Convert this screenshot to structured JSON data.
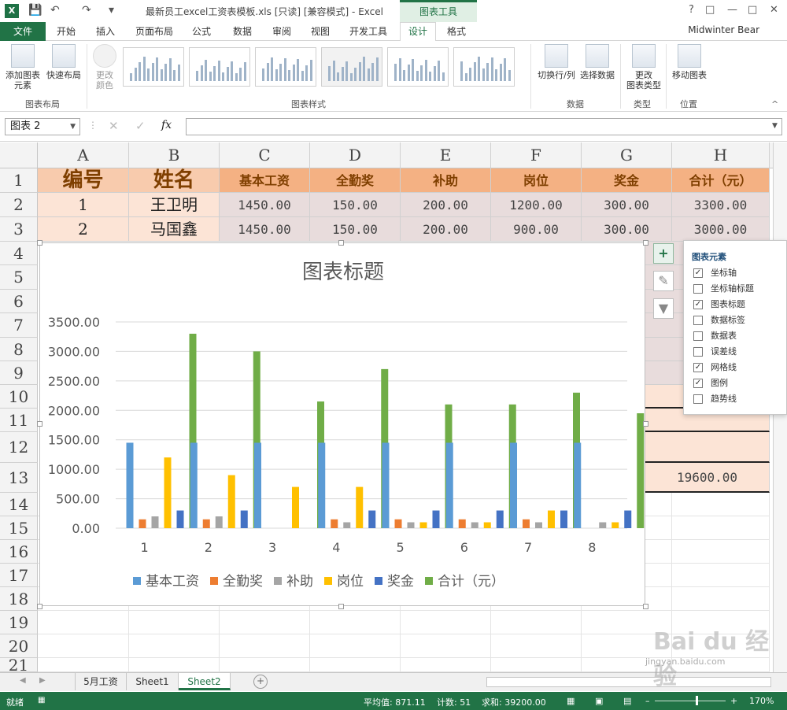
{
  "window": {
    "doc_title": "最新员工excel工资表模板.xls  [只读]  [兼容模式] - Excel",
    "tool_tab": "图表工具",
    "user": "Midwinter Bear",
    "app_icon": "X"
  },
  "tabs": [
    "文件",
    "开始",
    "插入",
    "页面布局",
    "公式",
    "数据",
    "审阅",
    "视图",
    "开发工具",
    "设计",
    "格式"
  ],
  "ribbon": {
    "add_element": "添加图表",
    "add_element2": "元素",
    "quick_layout": "快速布局",
    "change_color": "更改",
    "change_color2": "颜色",
    "group_layout": "图表布局",
    "group_styles": "图表样式",
    "switch_row_col": "切换行/列",
    "select_data": "选择数据",
    "group_data": "数据",
    "change_type": "更改",
    "change_type2": "图表类型",
    "group_type": "类型",
    "move_chart": "移动图表",
    "group_location": "位置"
  },
  "formula": {
    "namebox": "图表 2",
    "fx": "fx"
  },
  "columns": [
    "A",
    "B",
    "C",
    "D",
    "E",
    "F",
    "G",
    "H"
  ],
  "rows": [
    "1",
    "2",
    "3",
    "4",
    "5",
    "6",
    "7",
    "8",
    "9",
    "10",
    "11",
    "12",
    "13",
    "14",
    "15",
    "16",
    "17",
    "18",
    "19",
    "20",
    "21"
  ],
  "table": {
    "headers": [
      "编号",
      "姓名",
      "基本工资",
      "全勤奖",
      "补助",
      "岗位",
      "奖金",
      "合计（元）"
    ],
    "row1": [
      "1",
      "王卫明",
      "1450.00",
      "150.00",
      "200.00",
      "1200.00",
      "300.00",
      "3300.00"
    ],
    "row2": [
      "2",
      "马国鑫",
      "1450.00",
      "150.00",
      "200.00",
      "900.00",
      "300.00",
      "3000.00"
    ],
    "total": "19600.00"
  },
  "chart_data": {
    "type": "bar",
    "title": "图表标题",
    "categories": [
      "1",
      "2",
      "3",
      "4",
      "5",
      "6",
      "7",
      "8"
    ],
    "ylim": [
      0,
      3500
    ],
    "yticks": [
      "3500.00",
      "3000.00",
      "2500.00",
      "2000.00",
      "1500.00",
      "1000.00",
      "500.00",
      "0.00"
    ],
    "grid": true,
    "legend": "bottom",
    "series": [
      {
        "name": "基本工资",
        "color": "#5b9bd5",
        "values": [
          1450,
          1450,
          1450,
          1450,
          1450,
          1450,
          1450,
          1450
        ]
      },
      {
        "name": "全勤奖",
        "color": "#ed7d31",
        "values": [
          150,
          150,
          0,
          150,
          150,
          150,
          150,
          0
        ]
      },
      {
        "name": "补助",
        "color": "#a5a5a5",
        "values": [
          200,
          200,
          0,
          100,
          100,
          100,
          100,
          100
        ]
      },
      {
        "name": "岗位",
        "color": "#ffc000",
        "values": [
          1200,
          900,
          700,
          700,
          100,
          100,
          300,
          100
        ]
      },
      {
        "name": "奖金",
        "color": "#4472c4",
        "values": [
          300,
          300,
          0,
          300,
          300,
          300,
          300,
          300
        ]
      },
      {
        "name": "合计（元）",
        "color": "#70ad47",
        "values": [
          3300,
          3000,
          2150,
          2700,
          2100,
          2100,
          2300,
          1950
        ]
      }
    ]
  },
  "elements_panel": {
    "title": "图表元素",
    "options": [
      {
        "label": "坐标轴",
        "checked": true
      },
      {
        "label": "坐标轴标题",
        "checked": false
      },
      {
        "label": "图表标题",
        "checked": true
      },
      {
        "label": "数据标签",
        "checked": false
      },
      {
        "label": "数据表",
        "checked": false
      },
      {
        "label": "误差线",
        "checked": false
      },
      {
        "label": "网格线",
        "checked": true
      },
      {
        "label": "图例",
        "checked": true
      },
      {
        "label": "趋势线",
        "checked": false
      }
    ]
  },
  "sheets": [
    "5月工资",
    "Sheet1",
    "Sheet2"
  ],
  "status": {
    "ready": "就绪",
    "average": "平均值: 871.11",
    "count": "计数: 51",
    "sum": "求和: 39200.00",
    "zoom": "170%"
  },
  "watermark": {
    "brand": "Bai du 经验",
    "url": "jingyan.baidu.com"
  }
}
